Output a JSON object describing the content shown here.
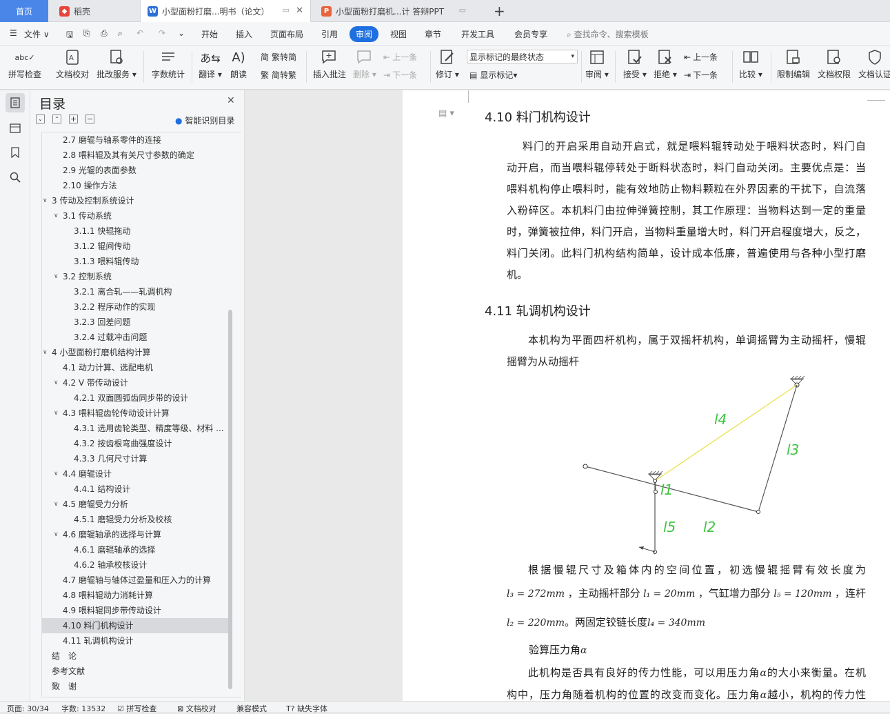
{
  "tabs": {
    "home": "首页",
    "daoke": "稻壳",
    "doc": "小型面粉打磨...明书（论文）",
    "ppt": "小型面粉打磨机...计 答辩PPT",
    "add": "+"
  },
  "menu": {
    "file": "文件",
    "items": [
      "开始",
      "插入",
      "页面布局",
      "引用",
      "审阅",
      "视图",
      "章节",
      "开发工具",
      "会员专享"
    ],
    "search": "查找命令、搜索模板"
  },
  "ribbon": {
    "spellcheck": "拼写检查",
    "doc_proof": "文档校对",
    "batch": "批改服务",
    "wordcount": "字数统计",
    "translate": "翻译",
    "read": "朗读",
    "trad": "繁转简",
    "simp": "简转繁",
    "insert_comment": "插入批注",
    "delete": "删除",
    "prev_comment": "上一条",
    "next_comment": "下一条",
    "revise": "修订",
    "markup_select": "显示标记的最终状态",
    "show_markup": "显示标记",
    "review_pane": "审阅",
    "accept": "接受",
    "reject": "拒绝",
    "prev_change": "上一条",
    "next_change": "下一条",
    "compare": "比较",
    "restrict": "限制编辑",
    "doc_rights": "文档权限",
    "doc_auth": "文档认证"
  },
  "toc": {
    "title": "目录",
    "smart": "智能识别目录",
    "items": [
      {
        "label": "2.7 磨辊与轴系零件的连接",
        "level": 2,
        "caret": false
      },
      {
        "label": "2.8 喂料辊及其有关尺寸参数的确定",
        "level": 2,
        "caret": false
      },
      {
        "label": "2.9 光辊的表面参数",
        "level": 2,
        "caret": false
      },
      {
        "label": "2.10 操作方法",
        "level": 2,
        "caret": false
      },
      {
        "label": "3 传动及控制系统设计",
        "level": 1,
        "caret": true
      },
      {
        "label": "3.1 传动系统",
        "level": 2,
        "caret": true
      },
      {
        "label": "3.1.1 快辊拖动",
        "level": 3,
        "caret": false
      },
      {
        "label": "3.1.2 辊间传动",
        "level": 3,
        "caret": false
      },
      {
        "label": "3.1.3 喂料辊传动",
        "level": 3,
        "caret": false
      },
      {
        "label": "3.2 控制系统",
        "level": 2,
        "caret": true
      },
      {
        "label": "3.2.1 离合轧——轧调机构",
        "level": 3,
        "caret": false
      },
      {
        "label": "3.2.2 程序动作的实现",
        "level": 3,
        "caret": false
      },
      {
        "label": "3.2.3 回差问题",
        "level": 3,
        "caret": false
      },
      {
        "label": "3.2.4 过载冲击问题",
        "level": 3,
        "caret": false
      },
      {
        "label": "4 小型面粉打磨机结构计算",
        "level": 1,
        "caret": true
      },
      {
        "label": "4.1 动力计算、选配电机",
        "level": 2,
        "caret": false
      },
      {
        "label": "4.2 V 带传动设计",
        "level": 2,
        "caret": true
      },
      {
        "label": "4.2.1 双面圆弧齿同步带的设计",
        "level": 3,
        "caret": false
      },
      {
        "label": "4.3 喂料辊齿轮传动设计计算",
        "level": 2,
        "caret": true
      },
      {
        "label": "4.3.1 选用齿轮类型、精度等级、材料 ...",
        "level": 3,
        "caret": false
      },
      {
        "label": "4.3.2 按齿根弯曲强度设计",
        "level": 3,
        "caret": false
      },
      {
        "label": "4.3.3 几何尺寸计算",
        "level": 3,
        "caret": false
      },
      {
        "label": "4.4 磨辊设计",
        "level": 2,
        "caret": true
      },
      {
        "label": "4.4.1 结构设计",
        "level": 3,
        "caret": false
      },
      {
        "label": "4.5 磨辊受力分析",
        "level": 2,
        "caret": true
      },
      {
        "label": "4.5.1 磨辊受力分析及校核",
        "level": 3,
        "caret": false
      },
      {
        "label": "4.6 磨辊轴承的选择与计算",
        "level": 2,
        "caret": true
      },
      {
        "label": "4.6.1 磨辊轴承的选择",
        "level": 3,
        "caret": false
      },
      {
        "label": "4.6.2 轴承校核设计",
        "level": 3,
        "caret": false
      },
      {
        "label": "4.7 磨辊轴与轴体过盈量和压入力的计算",
        "level": 2,
        "caret": false
      },
      {
        "label": "4.8 喂料辊动力消耗计算",
        "level": 2,
        "caret": false
      },
      {
        "label": "4.9 喂料辊同步带传动设计",
        "level": 2,
        "caret": false
      },
      {
        "label": "4.10 料门机构设计",
        "level": 2,
        "caret": false,
        "active": true
      },
      {
        "label": "4.11 轧调机构设计",
        "level": 2,
        "caret": false
      },
      {
        "label": "结　论",
        "level": 1,
        "caret": false
      },
      {
        "label": "参考文献",
        "level": 1,
        "caret": false
      },
      {
        "label": "致　谢",
        "level": 1,
        "caret": false
      }
    ]
  },
  "doc": {
    "h410": "4.10 料门机构设计",
    "p410": [
      "料门的开启采用自动开启式，就是喂料辊转动处于喂料状态时，料门自",
      "动开启，而当喂料辊停转处于断料状态时，料门自动关闭。主要优点是：当",
      "喂料机构停止喂料时，能有效地防止物料颗粒在外界因素的干扰下，自流落",
      "入粉碎区。本机料门由拉伸弹簧控制，其工作原理：当物料达到一定的重量",
      "时，弹簧被拉伸，料门开启，当物料重量增大时，料门开启程度增大，反之，",
      "料门关闭。此料门机构结构简单，设计成本低廉，普遍使用与各种小型打磨",
      "机。"
    ],
    "h411": "4.11 轧调机构设计",
    "p411": [
      "本机构为平面四杆机构，属于双摇杆机构，单调摇臂为主动摇杆，慢辊",
      "摇臂为从动摇杆"
    ],
    "fig_labels": {
      "l1": "l1",
      "l2": "l2",
      "l3": "l3",
      "l4": "l4",
      "l5": "l5"
    },
    "p_dim_1": "根据慢辊尺寸及箱体内的空间位置，初选慢辊摇臂有效长度为",
    "p_dim_2a": "l₃ = 272mm",
    "p_dim_2b": "，主动摇杆部分",
    "p_dim_2c": "l₁ = 20mm",
    "p_dim_2d": "，气缸增力部分",
    "p_dim_2e": "l₅ = 120mm",
    "p_dim_2f": "，连杆",
    "p_dim_3a": "l₂ = 220mm",
    "p_dim_3b": "。两固定铰链长度",
    "p_dim_3c": "l₄ = 340mm",
    "p_pressure": "验算压力角",
    "alpha": "α",
    "p_last_1a": "此机构是否具有良好的传力性能，可以用压力角",
    "p_last_1b": "的大小来衡量。在机",
    "p_last_2a": "构中，压力角随着机构的位置的改变而变化。压力角",
    "p_last_2b": "越小，机构的传力性"
  },
  "status": {
    "page": "页面: 30/34",
    "words": "字数: 13532",
    "spell": "拼写检查",
    "proof": "文档校对",
    "compat": "兼容模式",
    "font": "缺失字体"
  },
  "colors": {
    "accent": "#1e6fe0",
    "home_tab": "#4a86e8",
    "figure_green": "#3ec43e",
    "figure_yellow": "#e8e24a"
  }
}
